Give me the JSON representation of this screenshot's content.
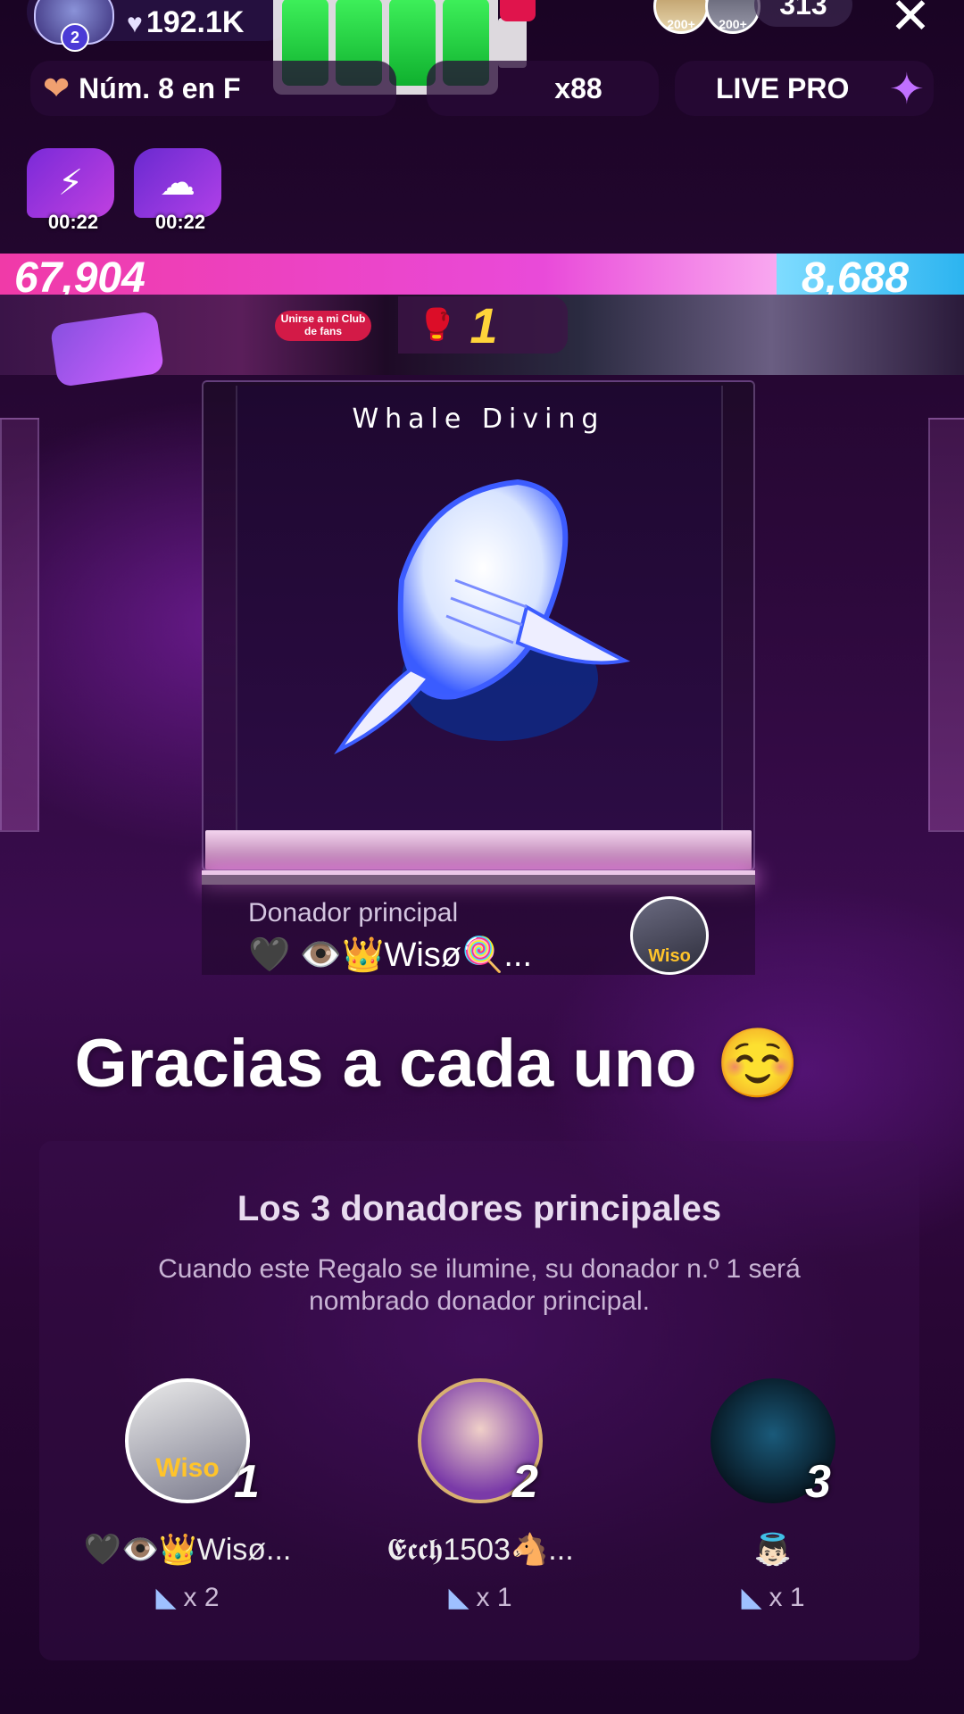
{
  "header": {
    "host_level": "2",
    "host_likes": "192.1K",
    "viewer_badges": [
      "200+",
      "200+"
    ],
    "viewer_count": "313",
    "close_icon": "close-icon"
  },
  "pills": {
    "rank_text": "Núm. 8 en F",
    "multiplier": "x88",
    "live_pro": "LIVE PRO"
  },
  "timers": [
    {
      "icon": "lightning-icon",
      "time": "00:22"
    },
    {
      "icon": "cloud-icon",
      "time": "00:22"
    }
  ],
  "battle": {
    "left_score": "67,904",
    "right_score": "8,688",
    "streak": "1",
    "fan_club_label": "Unirse a mi Club de fans"
  },
  "gift": {
    "name": "Whale Diving",
    "top_donor_label": "Donador principal",
    "top_donor_name": "🖤 👁️👑Wisø🍭...",
    "top_donor_avatar_text": "Wiso"
  },
  "thanks_message": "Gracias a cada uno ☺️",
  "top_donors": {
    "title": "Los 3 donadores principales",
    "description": "Cuando este Regalo se ilumine, su donador n.º 1 será nombrado donador principal.",
    "items": [
      {
        "rank": "1",
        "name": "🖤👁️👑Wisø...",
        "count": "x 2",
        "avatar_text": "Wiso"
      },
      {
        "rank": "2",
        "name": "𝕰𝖈𝖈𝖍1503🐴...",
        "count": "x 1",
        "avatar_text": ""
      },
      {
        "rank": "3",
        "name": "👼🏻",
        "count": "x 1",
        "avatar_text": ""
      }
    ]
  },
  "colors": {
    "battle_left": "#f03aa8",
    "battle_right": "#2cb4f0",
    "streak_number": "#ffd43a"
  }
}
